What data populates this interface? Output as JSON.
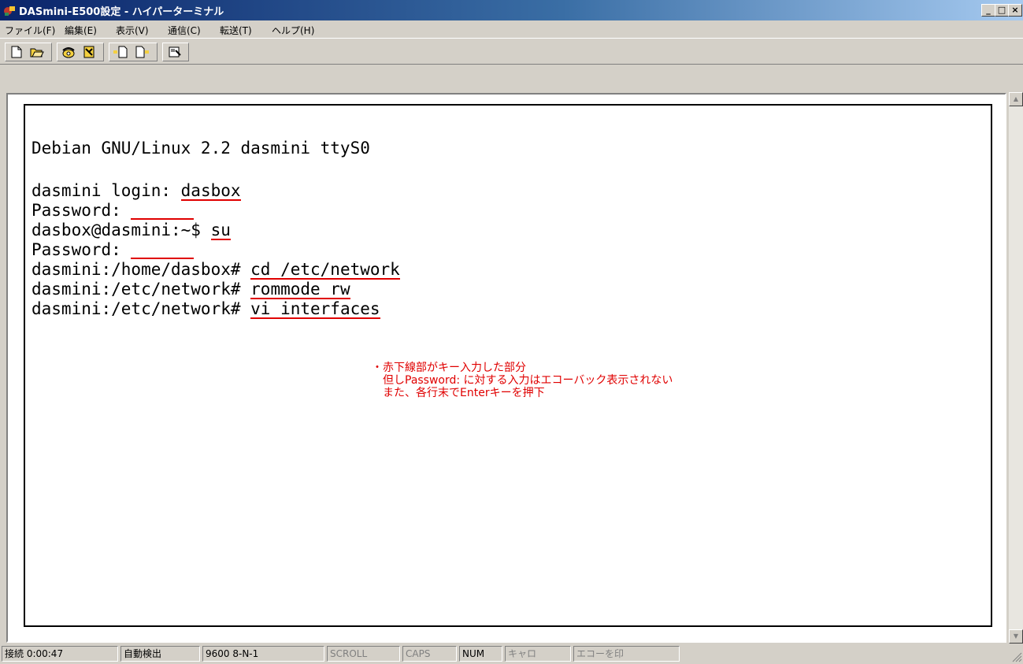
{
  "window": {
    "title": "DASmini-E500設定 - ハイパーターミナル",
    "minimize_label": "_",
    "maximize_label": "□",
    "close_label": "×"
  },
  "menu": {
    "items": [
      "ファイル(F)",
      "編集(E)",
      "表示(V)",
      "通信(C)",
      "転送(T)",
      "ヘルプ(H)"
    ]
  },
  "toolbar": {
    "buttons": [
      "new-file-icon",
      "open-folder-icon",
      "dial-phone-icon",
      "disconnect-phone-icon",
      "send-file-icon",
      "receive-file-icon",
      "properties-icon"
    ]
  },
  "terminal": {
    "lines": [
      {
        "prompt": "Debian GNU/Linux 2.2 dasmini ttyS0",
        "input": ""
      },
      {
        "prompt": "dasmini login: ",
        "input": "dasbox"
      },
      {
        "prompt": "Password: ",
        "input": ""
      },
      {
        "prompt": "dasbox@dasmini:~$ ",
        "input": "su"
      },
      {
        "prompt": "Password: ",
        "input": ""
      },
      {
        "prompt": "dasmini:/home/dasbox# ",
        "input": "cd /etc/network"
      },
      {
        "prompt": "dasmini:/etc/network# ",
        "input": "rommode rw"
      },
      {
        "prompt": "dasmini:/etc/network# ",
        "input": "vi interfaces"
      }
    ],
    "note": {
      "line1": "・赤下線部がキー入力した部分",
      "line2": "　但しPassword: に対する入力はエコーバック表示されない",
      "line3": "　また、各行末でEnterキーを押下"
    },
    "underline_color": "#e00000"
  },
  "statusbar": {
    "connect_time": "接続 0:00:47",
    "detect": "自動検出",
    "port_settings": "9600 8-N-1",
    "scroll": "SCROLL",
    "caps": "CAPS",
    "num": "NUM",
    "capture": "キャロ",
    "echo_print": "エコーを印"
  }
}
